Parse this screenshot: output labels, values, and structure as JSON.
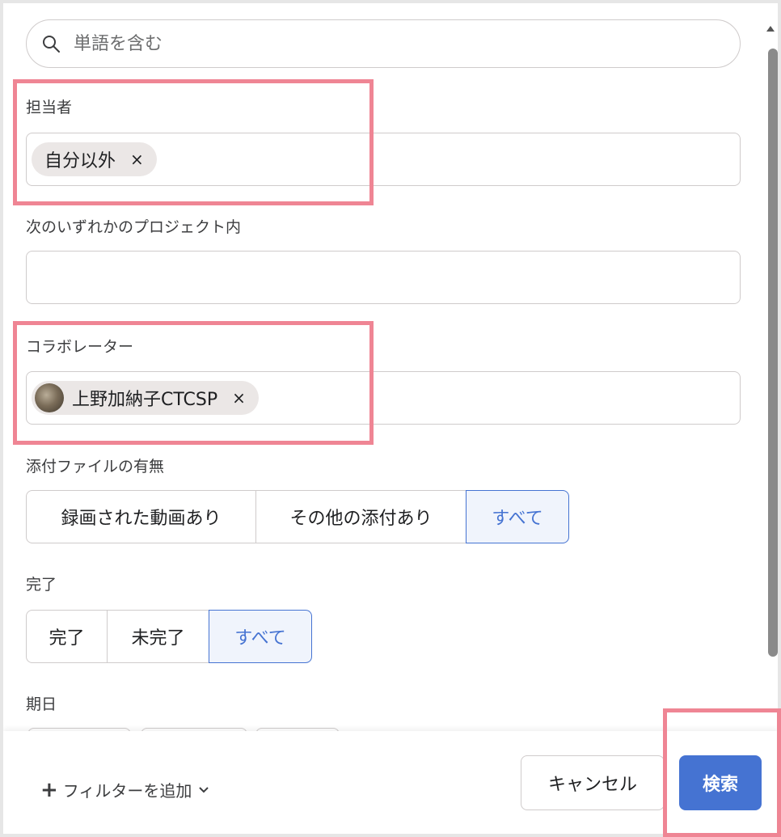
{
  "search": {
    "placeholder": "単語を含む"
  },
  "assignee": {
    "label": "担当者",
    "chip": "自分以外",
    "chip_remove": "×"
  },
  "project": {
    "label": "次のいずれかのプロジェクト内"
  },
  "collaborator": {
    "label": "コラボレーター",
    "chip": "上野加納子CTCSP",
    "chip_remove": "×"
  },
  "attachments": {
    "label": "添付ファイルの有無",
    "options": [
      "録画された動画あり",
      "その他の添付あり",
      "すべて"
    ],
    "selected": "すべて"
  },
  "completion": {
    "label": "完了",
    "options": [
      "完了",
      "未完了",
      "すべて"
    ],
    "selected": "すべて"
  },
  "due_date": {
    "label": "期日"
  },
  "footer": {
    "add_filter": "フィルターを追加",
    "cancel": "キャンセル",
    "search": "検索"
  },
  "colors": {
    "accent": "#4573d2",
    "highlight": "#ef8594"
  },
  "icons": {
    "search": "search-icon",
    "chevron": "chevron-down-icon",
    "avatar": "avatar"
  }
}
